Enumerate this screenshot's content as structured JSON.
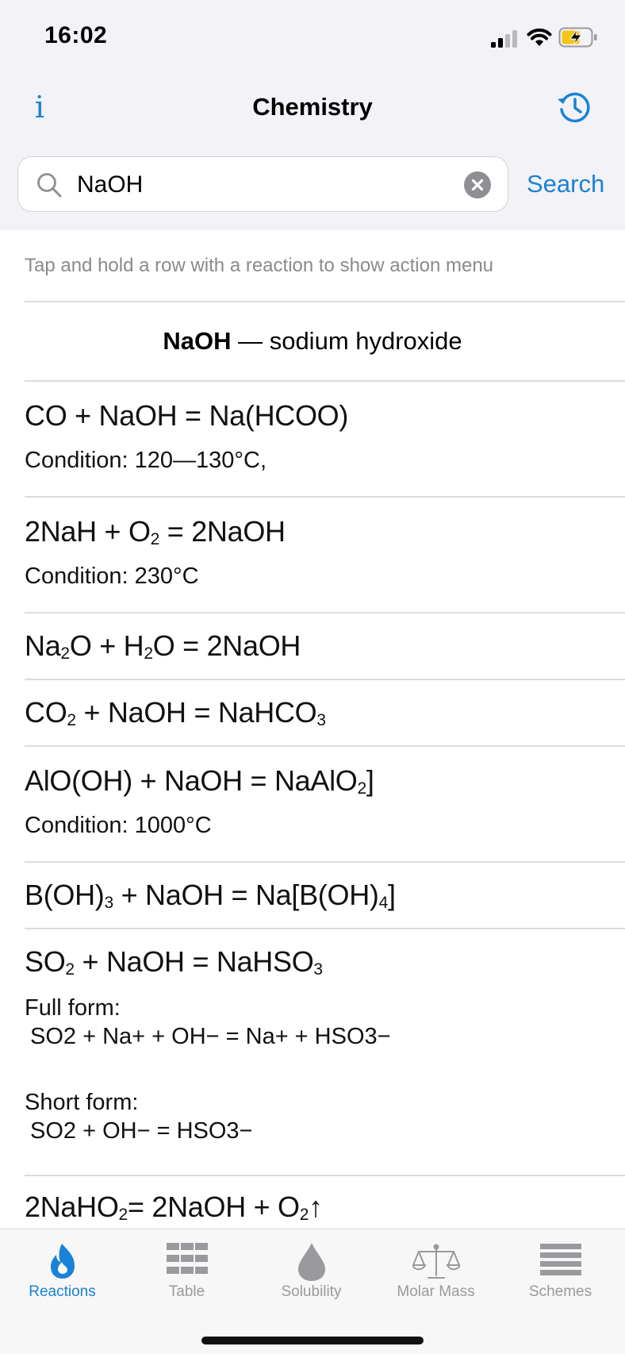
{
  "status": {
    "time": "16:02"
  },
  "nav": {
    "title": "Chemistry",
    "info_icon": "info-icon",
    "history_icon": "history-icon"
  },
  "search": {
    "value": "NaOH",
    "placeholder": "Search",
    "button": "Search"
  },
  "hint": "Tap and hold a row with a reaction to show action menu",
  "compound": {
    "formula": "NaOH",
    "separator": " — ",
    "name": "sodium hydroxide"
  },
  "reactions": [
    {
      "equation": "CO + NaOH = Na(HCOO)",
      "condition": "Condition: 120—130°C,"
    },
    {
      "eq": [
        "2NaH + O",
        "2",
        " = 2NaOH"
      ],
      "condition": "Condition: 230°C"
    },
    {
      "eq": [
        "Na",
        "2",
        "O + H",
        "2",
        "O = 2NaOH"
      ]
    },
    {
      "eq": [
        "CO",
        "2",
        " + NaOH = NaHCO",
        "3"
      ]
    },
    {
      "eq": [
        "AlO(OH) + NaOH = NaAlO",
        "2",
        "]"
      ],
      "condition": "Condition: 1000°C"
    },
    {
      "eq": [
        "B(OH)",
        "3",
        " + NaOH = Na[B(OH)",
        "4",
        "]"
      ]
    },
    {
      "eq": [
        "SO",
        "2",
        " + NaOH = NaHSO",
        "3"
      ],
      "full_label": "Full form:",
      "full_value": "SO2 + Na+ + OH− = Na+ + HSO3−",
      "short_label": "Short form:",
      "short_value": "SO2 + OH− = HSO3−"
    },
    {
      "eq": [
        "2NaHO",
        "2",
        "= 2NaOH + O",
        "2",
        "↑"
      ]
    }
  ],
  "tabs": [
    {
      "label": "Reactions",
      "icon": "flame-icon",
      "active": true
    },
    {
      "label": "Table",
      "icon": "table-grid-icon",
      "active": false
    },
    {
      "label": "Solubility",
      "icon": "drop-icon",
      "active": false
    },
    {
      "label": "Molar Mass",
      "icon": "scales-icon",
      "active": false
    },
    {
      "label": "Schemes",
      "icon": "lines-icon",
      "active": false
    }
  ],
  "colors": {
    "accent": "#1a82d6",
    "inactive": "#9a9a9e",
    "background_top": "#f2f2f7",
    "battery_fill": "#f5c518"
  }
}
